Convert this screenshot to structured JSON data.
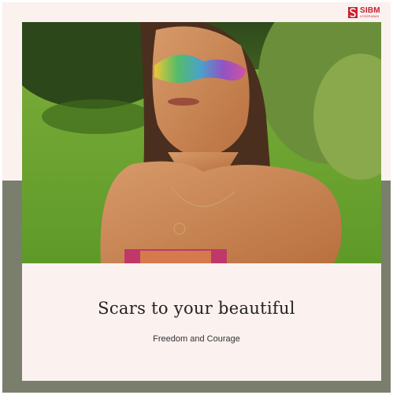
{
  "brand": {
    "name": "SIBM",
    "sub": "HYDERABAD",
    "color": "#c8202f"
  },
  "post": {
    "title": "Scars to your beautiful",
    "subtitle": "Freedom and Courage"
  },
  "colors": {
    "top_background": "#fbf1ef",
    "bottom_background": "#7a7e6d",
    "card": "#fbf1ef"
  }
}
